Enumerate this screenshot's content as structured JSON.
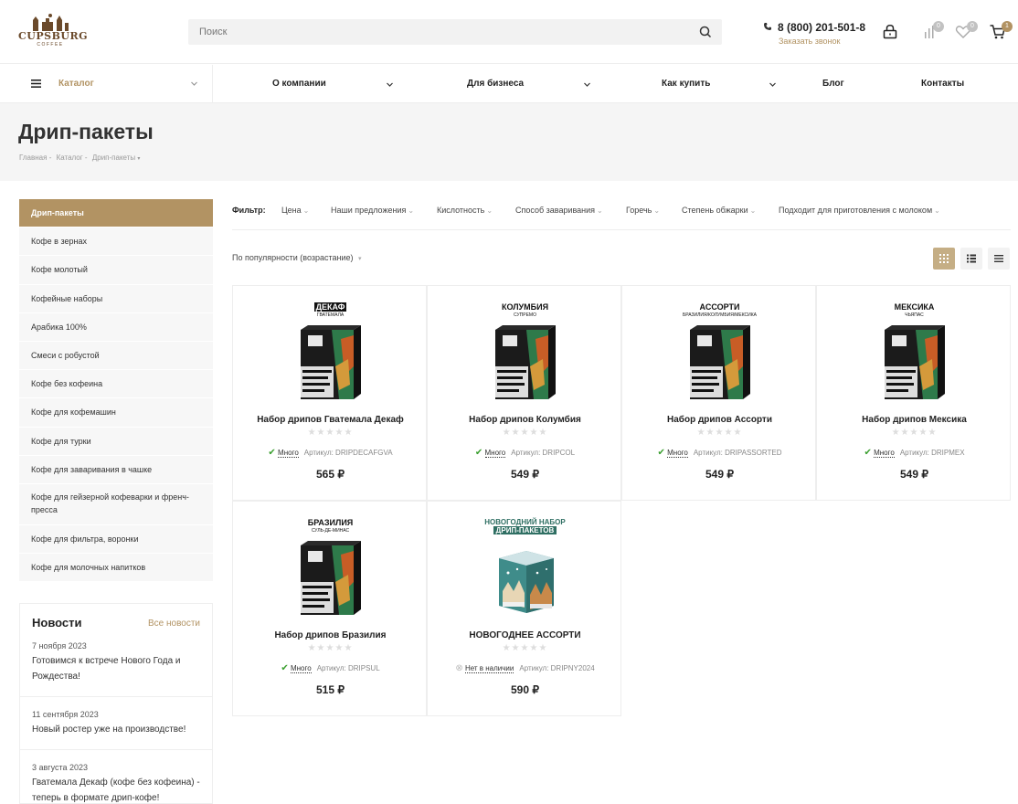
{
  "header": {
    "logo_text": "CUPSBURG",
    "logo_sub": "COFFEE",
    "search_placeholder": "Поиск",
    "phone": "8 (800) 201-501-8",
    "callback": "Заказать звонок",
    "compare_count": "0",
    "favorites_count": "0",
    "cart_count": "1"
  },
  "nav": {
    "catalog": "Каталог",
    "items": [
      "О компании",
      "Для бизнеса",
      "Как купить",
      "Блог",
      "Контакты"
    ]
  },
  "page": {
    "title": "Дрип-пакеты",
    "breadcrumbs": [
      "Главная",
      "-",
      "Каталог",
      "-",
      "Дрип-пакеты"
    ]
  },
  "sidebar": {
    "items": [
      "Дрип-пакеты",
      "Кофе в зернах",
      "Кофе молотый",
      "Кофейные наборы",
      "Арабика 100%",
      "Смеси с робустой",
      "Кофе без кофеина",
      "Кофе для кофемашин",
      "Кофе для турки",
      "Кофе для заваривания в чашке",
      "Кофе для гейзерной кофеварки и френч-пресса",
      "Кофе для фильтра, воронки",
      "Кофе для молочных напитков"
    ]
  },
  "news": {
    "title": "Новости",
    "all_link": "Все новости",
    "items": [
      {
        "date": "7 ноября 2023",
        "text": "Готовимся к встрече Нового Года и Рождества!"
      },
      {
        "date": "11 сентября 2023",
        "text": "Новый ростер уже на производстве!"
      },
      {
        "date": "3 августа 2023",
        "text": "Гватемала Декаф (кофе без кофеина) - теперь в формате дрип-кофе!"
      }
    ]
  },
  "filters": {
    "label": "Фильтр:",
    "items": [
      "Цена",
      "Наши предложения",
      "Кислотность",
      "Способ заваривания",
      "Горечь",
      "Степень обжарки",
      "Подходит для приготовления с молоком"
    ]
  },
  "sort": {
    "label": "По популярности (возрастание)"
  },
  "products": [
    {
      "label1": "ДЕКАФ",
      "label2": "ГВАТЕМАЛА",
      "name": "Набор дрипов Гватемала Декаф",
      "stock": "Много",
      "article": "Артикул: DRIPDECAFGVA",
      "price": "565 ₽",
      "in_stock": true
    },
    {
      "label1": "КОЛУМБИЯ",
      "label2": "СУПРЕМО",
      "name": "Набор дрипов Колумбия",
      "stock": "Много",
      "article": "Артикул: DRIPCOL",
      "price": "549 ₽",
      "in_stock": true
    },
    {
      "label1": "АССОРТИ",
      "label2": "БРАЗИЛИЯ/КОЛУМБИЯ/МЕКСИКА",
      "name": "Набор дрипов Ассорти",
      "stock": "Много",
      "article": "Артикул: DRIPASSORTED",
      "price": "549 ₽",
      "in_stock": true
    },
    {
      "label1": "МЕКСИКА",
      "label2": "ЧЬЯПАС",
      "name": "Набор дрипов Мексика",
      "stock": "Много",
      "article": "Артикул: DRIPMEX",
      "price": "549 ₽",
      "in_stock": true
    },
    {
      "label1": "БРАЗИЛИЯ",
      "label2": "СУЛЬ-ДЕ-МИНАС",
      "name": "Набор дрипов Бразилия",
      "stock": "Много",
      "article": "Артикул: DRIPSUL",
      "price": "515 ₽",
      "in_stock": true
    },
    {
      "label1": "НОВОГОДНИЙ НАБОР",
      "label2": "ДРИП-ПАКЕТОВ",
      "name": "НОВОГОДНЕЕ АССОРТИ",
      "stock": "Нет в наличии",
      "article": "Артикул: DRIPNY2024",
      "price": "590 ₽",
      "in_stock": false
    }
  ],
  "colors": {
    "accent": "#b29363",
    "in_stock": "#3a9f2f"
  }
}
